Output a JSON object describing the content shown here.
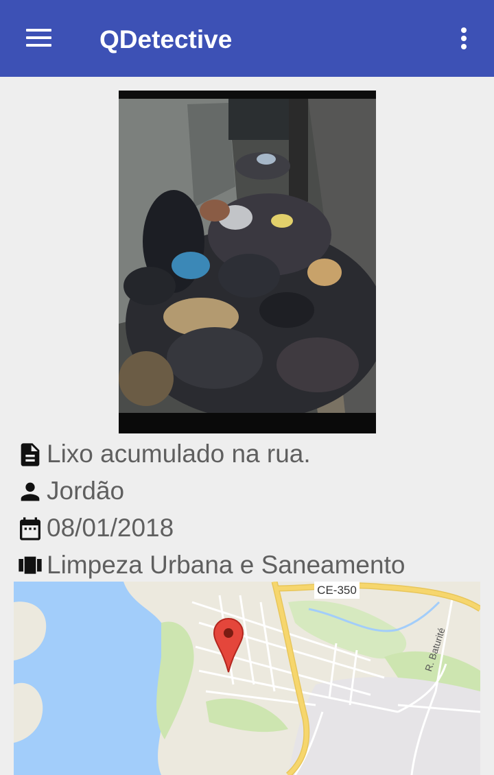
{
  "app": {
    "title": "QDetective"
  },
  "appbar_icons": {
    "menu": "menu-icon",
    "overflow": "more-vert-icon"
  },
  "photo": {
    "subject": "photo of garbage bags piled up on a street sidewalk"
  },
  "report": {
    "description": "Lixo acumulado na rua.",
    "author": "Jordão",
    "date": "08/01/2018",
    "category": "Limpeza Urbana e Saneamento"
  },
  "report_icons": {
    "description": "description-icon",
    "author": "person-icon",
    "date": "calendar-icon",
    "category": "view-carousel-icon"
  },
  "map": {
    "road_label": "CE-350",
    "street_label": "R. Baturité",
    "marker": "map-marker-icon"
  },
  "colors": {
    "appbar": "#3d51b5",
    "background": "#eeeeee",
    "text": "#5f5f5f",
    "water": "#a2cdfa",
    "park": "#cde5b0",
    "land": "#ece9de",
    "highway": "#f6d66d",
    "marker": "#e4463b"
  }
}
